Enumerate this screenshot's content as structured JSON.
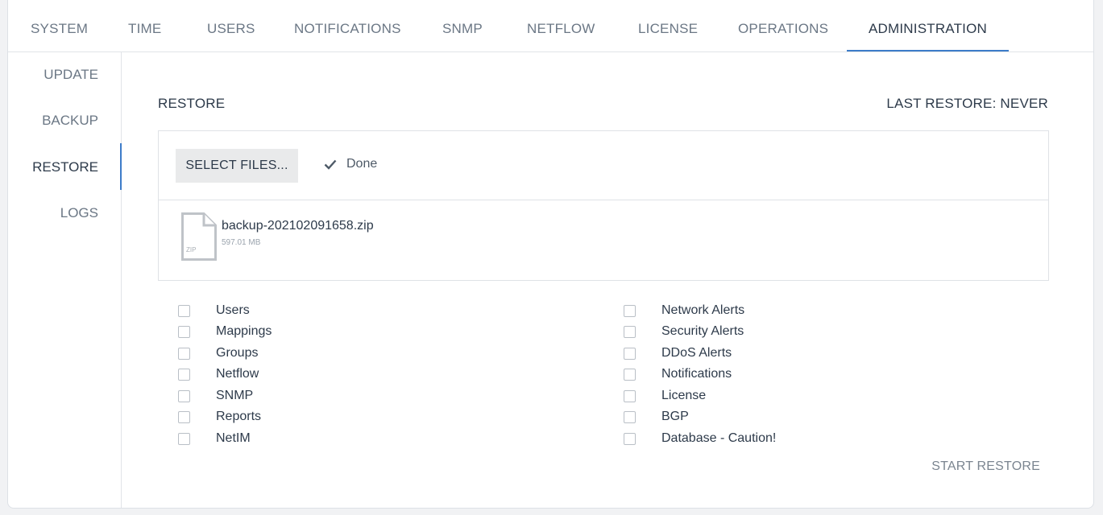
{
  "tabs": [
    {
      "label": "SYSTEM"
    },
    {
      "label": "TIME"
    },
    {
      "label": "USERS"
    },
    {
      "label": "NOTIFICATIONS"
    },
    {
      "label": "SNMP"
    },
    {
      "label": "NETFLOW"
    },
    {
      "label": "LICENSE"
    },
    {
      "label": "OPERATIONS"
    },
    {
      "label": "ADMINISTRATION"
    }
  ],
  "active_tab": "ADMINISTRATION",
  "sidenav": {
    "items": [
      {
        "label": "UPDATE"
      },
      {
        "label": "BACKUP"
      },
      {
        "label": "RESTORE"
      },
      {
        "label": "LOGS"
      }
    ],
    "active": "RESTORE"
  },
  "restore": {
    "title": "RESTORE",
    "last_restore": "LAST RESTORE: NEVER",
    "select_files_label": "SELECT FILES...",
    "status_text": "Done",
    "file": {
      "name": "backup-202102091658.zip",
      "size": "597.01 MB",
      "type_label": "ZIP"
    },
    "options_left": [
      {
        "label": "Users",
        "checked": false
      },
      {
        "label": "Mappings",
        "checked": false
      },
      {
        "label": "Groups",
        "checked": false
      },
      {
        "label": "Netflow",
        "checked": false
      },
      {
        "label": "SNMP",
        "checked": false
      },
      {
        "label": "Reports",
        "checked": false
      },
      {
        "label": "NetIM",
        "checked": false
      }
    ],
    "options_right": [
      {
        "label": "Network Alerts",
        "checked": false
      },
      {
        "label": "Security Alerts",
        "checked": false
      },
      {
        "label": "DDoS Alerts",
        "checked": false
      },
      {
        "label": "Notifications",
        "checked": false
      },
      {
        "label": "License",
        "checked": false
      },
      {
        "label": "BGP",
        "checked": false
      },
      {
        "label": "Database - Caution!",
        "checked": false
      }
    ],
    "start_label": "START RESTORE"
  },
  "colors": {
    "accent": "#3d7cc9",
    "text": "#2d3a4a",
    "muted": "#6b7785"
  }
}
